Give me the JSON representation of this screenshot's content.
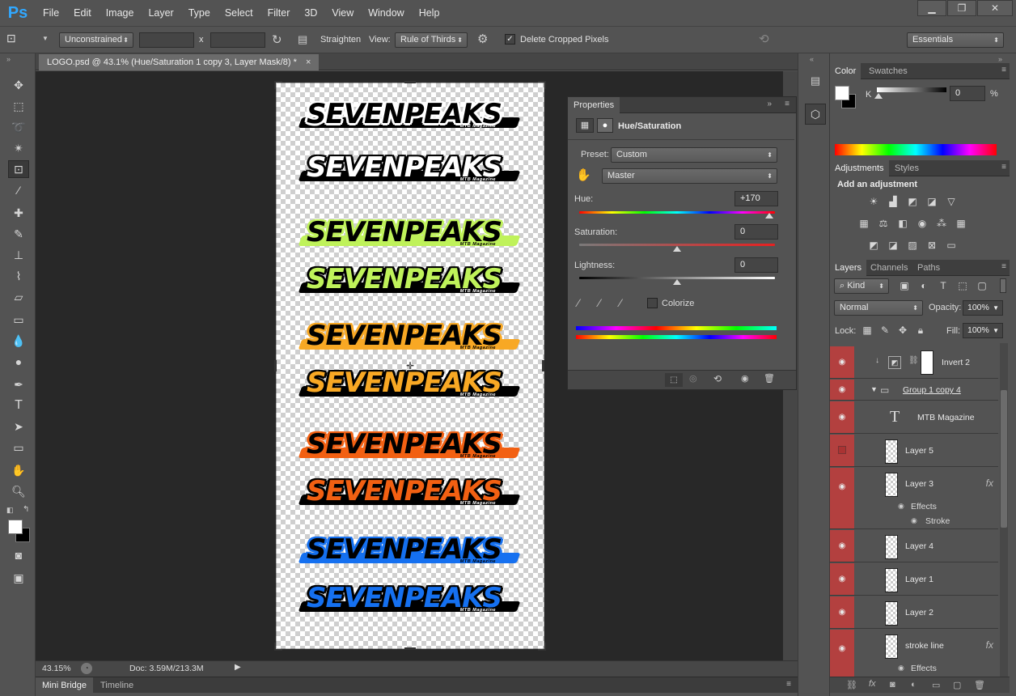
{
  "app": {
    "logo": "Ps"
  },
  "menu": [
    "File",
    "Edit",
    "Image",
    "Layer",
    "Type",
    "Select",
    "Filter",
    "3D",
    "View",
    "Window",
    "Help"
  ],
  "window_controls": {
    "minimize": "▁",
    "restore": "❐",
    "close": "✕"
  },
  "options": {
    "ratio": "Unconstrained",
    "width_value": "",
    "x_label": "x",
    "height_value": "",
    "straighten": "Straighten",
    "view_label": "View:",
    "view_value": "Rule of Thirds",
    "delete_cropped": "Delete Cropped Pixels",
    "delete_cropped_checked": true,
    "workspace": "Essentials"
  },
  "document": {
    "tab_title": "LOGO.psd @ 43.1% (Hue/Saturation 1 copy 3, Layer Mask/8) *",
    "tab_close": "×",
    "zoom": "43.15%",
    "doc_info": "Doc: 3.59M/213.3M"
  },
  "canvas_logos": [
    {
      "text": "SEVENPEAKS",
      "sub": "MTB Magazine",
      "fill": "#000000",
      "outline": "#ffffff",
      "bar": "#000000"
    },
    {
      "text": "SEVENPEAKS",
      "sub": "MTB Magazine",
      "fill": "#ffffff",
      "outline": "#000000",
      "bar": "#000000"
    },
    {
      "text": "SEVENPEAKS",
      "sub": "MTB Magazine",
      "fill": "#000000",
      "outline": "#bff25a",
      "bar": "#bff25a"
    },
    {
      "text": "SEVENPEAKS",
      "sub": "MTB Magazine",
      "fill": "#bff25a",
      "outline": "#000000",
      "bar": "#000000"
    },
    {
      "text": "SEVENPEAKS",
      "sub": "MTB Magazine",
      "fill": "#000000",
      "outline": "#f8a824",
      "bar": "#f8a824"
    },
    {
      "text": "SEVENPEAKS",
      "sub": "MTB Magazine",
      "fill": "#f8a824",
      "outline": "#000000",
      "bar": "#000000"
    },
    {
      "text": "SEVENPEAKS",
      "sub": "MTB Magazine",
      "fill": "#000000",
      "outline": "#f26012",
      "bar": "#f26012"
    },
    {
      "text": "SEVENPEAKS",
      "sub": "MTB Magazine",
      "fill": "#f26012",
      "outline": "#000000",
      "bar": "#000000"
    },
    {
      "text": "SEVENPEAKS",
      "sub": "MTB Magazine",
      "fill": "#000000",
      "outline": "#1570f0",
      "bar": "#1570f0"
    },
    {
      "text": "SEVENPEAKS",
      "sub": "MTB Magazine",
      "fill": "#1570f0",
      "outline": "#000000",
      "bar": "#000000"
    }
  ],
  "properties": {
    "tab": "Properties",
    "title": "Hue/Saturation",
    "preset_label": "Preset:",
    "preset_value": "Custom",
    "channel_value": "Master",
    "hue_label": "Hue:",
    "hue_value": "+170",
    "saturation_label": "Saturation:",
    "saturation_value": "0",
    "lightness_label": "Lightness:",
    "lightness_value": "0",
    "colorize": "Colorize",
    "hue_level": 0.97,
    "saturation_level": 0.5,
    "lightness_level": 0.5
  },
  "color_panel": {
    "tabs": [
      "Color",
      "Swatches"
    ],
    "k_label": "K",
    "k_value": "0",
    "percent": "%"
  },
  "adjustments_panel": {
    "tabs": [
      "Adjustments",
      "Styles"
    ],
    "heading": "Add an adjustment"
  },
  "layers_panel": {
    "tabs": [
      "Layers",
      "Channels",
      "Paths"
    ],
    "kind": "Kind",
    "blend_mode": "Normal",
    "opacity_label": "Opacity:",
    "opacity_value": "100%",
    "lock_label": "Lock:",
    "fill_label": "Fill:",
    "fill_value": "100%",
    "layers": [
      {
        "name": "Invert 2",
        "type": "adjustment"
      },
      {
        "name": "Group 1 copy 4",
        "type": "group"
      },
      {
        "name": "MTB Magazine",
        "type": "text"
      },
      {
        "name": "Layer 5",
        "type": "pixel",
        "hidden": true
      },
      {
        "name": "Layer 3",
        "type": "pixel",
        "fx": true,
        "effects": [
          "Effects",
          "Stroke"
        ]
      },
      {
        "name": "Layer 4",
        "type": "pixel"
      },
      {
        "name": "Layer 1",
        "type": "pixel"
      },
      {
        "name": "Layer 2",
        "type": "pixel"
      },
      {
        "name": "stroke line",
        "type": "pixel",
        "fx": true,
        "effects": [
          "Effects"
        ]
      }
    ],
    "fx_label": "fx"
  },
  "bottom_tabs": [
    "Mini Bridge",
    "Timeline"
  ]
}
